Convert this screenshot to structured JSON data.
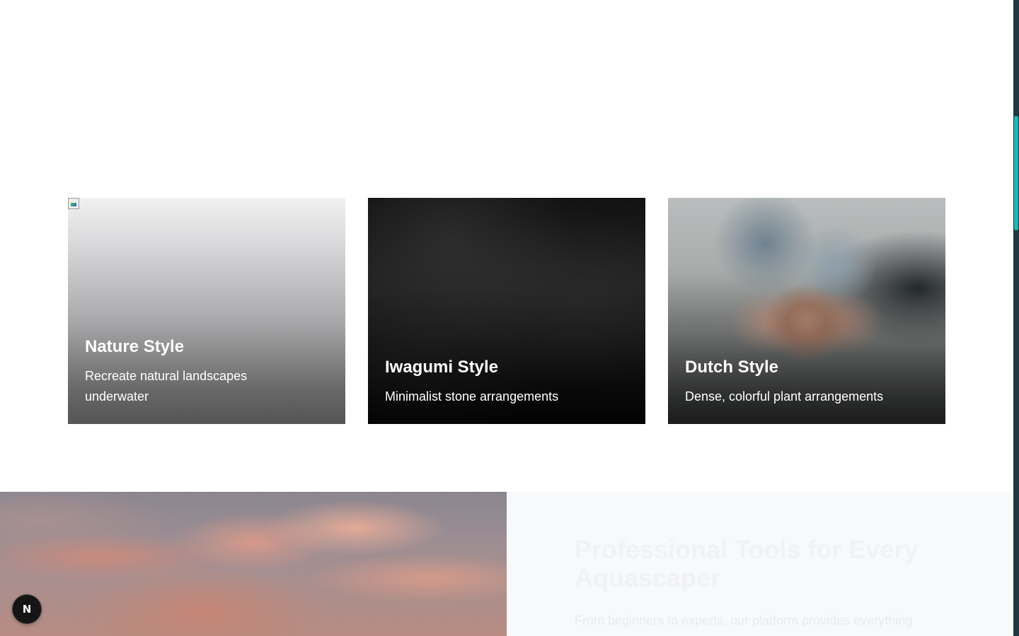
{
  "styles": {
    "cards": [
      {
        "title": "Nature Style",
        "description": "Recreate natural landscapes underwater"
      },
      {
        "title": "Iwagumi Style",
        "description": "Minimalist stone arrangements"
      },
      {
        "title": "Dutch Style",
        "description": "Dense, colorful plant arrangements"
      }
    ]
  },
  "tools": {
    "heading": "Professional Tools for Every Aquascaper",
    "subtitle": "From beginners to experts, our platform provides everything"
  },
  "badge": {
    "letter": "N"
  },
  "colors": {
    "scroll_track": "#1c3a3f",
    "scroll_thumb": "#1fb5b8",
    "panel_bg": "#f8f9fb"
  }
}
